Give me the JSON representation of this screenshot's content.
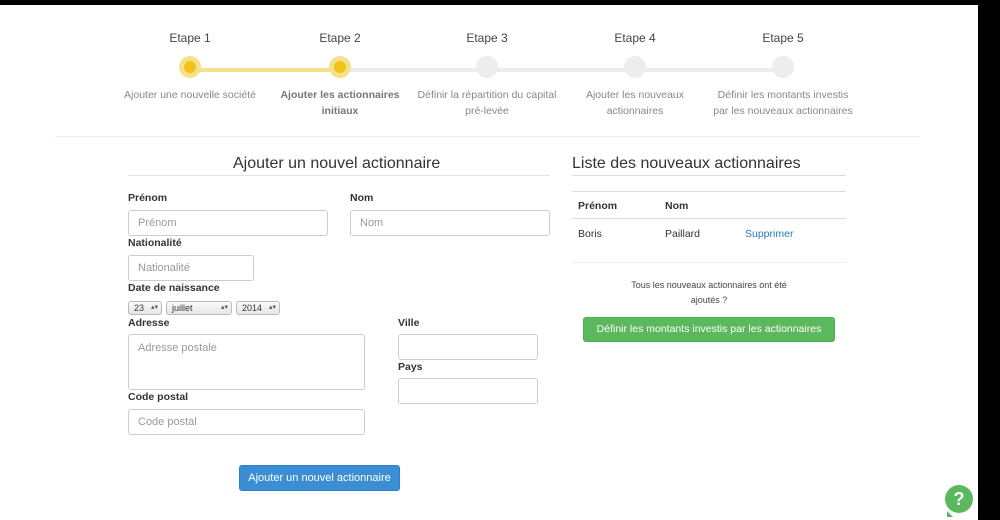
{
  "stepper": {
    "steps": [
      {
        "title": "Etape 1",
        "desc_1": "Ajouter une nouvelle société",
        "desc_2": ""
      },
      {
        "title": "Etape 2",
        "desc_1": "Ajouter les actionnaires",
        "desc_2": "initiaux"
      },
      {
        "title": "Etape 3",
        "desc_1": "Définir la répartition du capital",
        "desc_2": "pré-levée"
      },
      {
        "title": "Etape 4",
        "desc_1": "Ajouter les nouveaux",
        "desc_2": "actionnaires"
      },
      {
        "title": "Etape 5",
        "desc_1": "Définir les montants investis",
        "desc_2": "par les nouveaux actionnaires"
      }
    ],
    "current_step": 2
  },
  "form": {
    "title": "Ajouter un nouvel actionnaire",
    "prenom_label": "Prénom",
    "prenom_placeholder": "Prénom",
    "nom_label": "Nom",
    "nom_placeholder": "Nom",
    "nationalite_label": "Nationalité",
    "nationalite_placeholder": "Nationalité",
    "naissance_label": "Date de naissance",
    "day_value": "23",
    "month_value": "juillet",
    "year_value": "2014",
    "adresse_label": "Adresse",
    "adresse_placeholder": "Adresse postale",
    "ville_label": "Ville",
    "pays_label": "Pays",
    "code_label": "Code postal",
    "code_placeholder": "Code postal",
    "submit_label": "Ajouter un nouvel actionnaire"
  },
  "list": {
    "title": "Liste des nouveaux actionnaires",
    "columns": [
      "Prénom",
      "Nom"
    ],
    "rows": [
      {
        "prenom": "Boris",
        "nom": "Paillard",
        "action": "Supprimer"
      }
    ],
    "note_line1": "Tous les nouveaux actionnaires ont été",
    "note_line2": "ajoutés ?",
    "confirm_button": "Définir les montants investis par les actionnaires"
  },
  "help": {
    "icon": "question-icon",
    "label": "?"
  },
  "colors": {
    "step_done": "#f1c21b",
    "primary": "#3b8ed4",
    "success": "#5cb85c",
    "link": "#2a7ac2"
  }
}
